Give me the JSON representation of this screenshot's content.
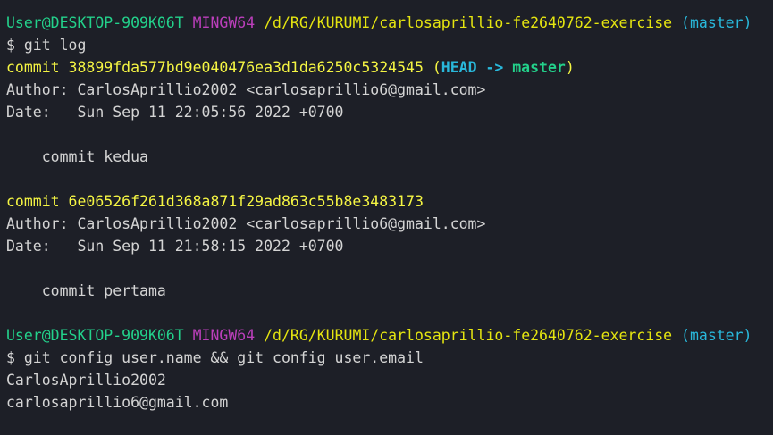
{
  "colors": {
    "background": "#1d1f27",
    "foreground": "#d4d4d4",
    "prompt_user": "#23d18b",
    "prompt_mingw": "#bc3fbc",
    "prompt_path": "#e5e510",
    "prompt_branch": "#29b8db",
    "commit_hash": "#f5f543",
    "head_ref": "#29b8db",
    "branch_ref": "#23d18b"
  },
  "prompt1": {
    "user_host": "User@DESKTOP-909K06T",
    "env": "MINGW64",
    "path": "/d/RG/KURUMI/carlosaprillio-fe2640762-exercise",
    "branch": "(master)"
  },
  "cmd1": "$ git log",
  "commits": [
    {
      "hash_line": "commit 38899fda577bd9e040476ea3d1da6250c5324545",
      "ref_open": "(",
      "head": "HEAD ->",
      "branch": "master",
      "ref_close": ")",
      "author": "Author: CarlosAprillio2002 <carlosaprillio6@gmail.com>",
      "date": "Date:   Sun Sep 11 22:05:56 2022 +0700",
      "message": "    commit kedua"
    },
    {
      "hash_line": "commit 6e06526f261d368a871f29ad863c55b8e3483173",
      "author": "Author: CarlosAprillio2002 <carlosaprillio6@gmail.com>",
      "date": "Date:   Sun Sep 11 21:58:15 2022 +0700",
      "message": "    commit pertama"
    }
  ],
  "prompt2": {
    "user_host": "User@DESKTOP-909K06T",
    "env": "MINGW64",
    "path": "/d/RG/KURUMI/carlosaprillio-fe2640762-exercise",
    "branch": "(master)"
  },
  "cmd2": "$ git config user.name && git config user.email",
  "output": [
    "CarlosAprillio2002",
    "carlosaprillio6@gmail.com"
  ]
}
